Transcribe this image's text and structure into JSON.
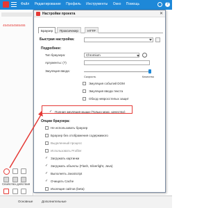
{
  "topbar": {
    "menu": [
      "Файл",
      "Редактирование",
      "Профиль",
      "Инструменты",
      "Окно",
      "Помощь"
    ]
  },
  "left_panel": {
    "project_id": "4545454565465",
    "props_label": "Свойства действия",
    "bottom_tabs": [
      "Основные",
      "Дополнительные"
    ]
  },
  "dialog": {
    "title": "Настройки проекта",
    "tabs": [
      "Браузер",
      "Проксичекер",
      "HTTP"
    ],
    "quick_settings_label": "Быстрая настройка:",
    "more_label": "Подробнее:",
    "fields": {
      "browser_type_label": "Тип браузера:",
      "browser_type_value": "Chromium",
      "args_label": "Аргументы: (?)",
      "emulation_label": "Эмуляция ввода:"
    },
    "slider": {
      "left_label": "Скорость",
      "right_label": "Качество",
      "value": 1.0
    },
    "emulation_options": [
      {
        "label": "Эмуляция событий DOM",
        "checked": false
      },
      {
        "label": "Эмуляция ввода текста",
        "checked": false
      },
      {
        "label": "Обход невросстелых защит",
        "checked": false
      },
      {
        "label": "Полная эмуляция мыши (Только макс. качество)",
        "checked": true
      }
    ],
    "browser_options_label": "Опции браузера:",
    "browser_options": [
      {
        "label": "Не использовать браузер",
        "checked": false
      },
      {
        "label": "Браузер без отображения содержимого",
        "checked": false
      },
      {
        "label": "Выделенный процесс",
        "checked": false
      },
      {
        "label": "Использовать Profiler",
        "checked": false
      },
      {
        "label": "Загружать картинки",
        "checked": true
      },
      {
        "label": "Загружать объекты (Flash, Silverlight, Java)",
        "checked": true
      },
      {
        "label": "Выполнять JavaScript",
        "checked": true
      },
      {
        "label": "Очищать Cache",
        "checked": true
      },
      {
        "label": "Изоляция сайтов (beta)",
        "checked": false
      }
    ]
  }
}
